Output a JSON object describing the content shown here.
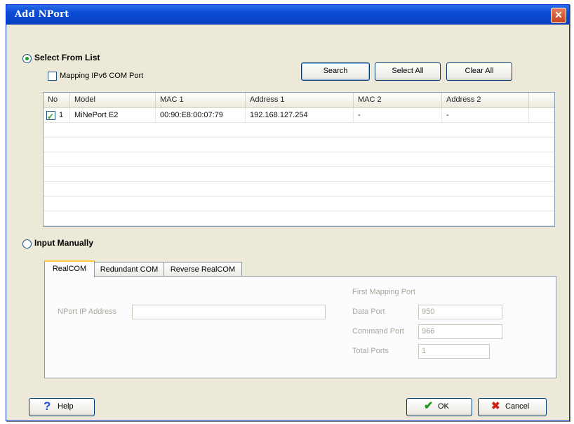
{
  "window": {
    "title": "Add NPort",
    "close_glyph": "✕"
  },
  "select_from_list": {
    "label": "Select From List",
    "mapping_ipv6_label": "Mapping IPv6 COM Port",
    "buttons": {
      "search": "Search",
      "select_all": "Select All",
      "clear_all": "Clear All"
    },
    "columns": [
      "No",
      "Model",
      "MAC 1",
      "Address 1",
      "MAC 2",
      "Address 2"
    ],
    "rows": [
      {
        "no": "1",
        "model": "MiNePort E2",
        "mac1": "00:90:E8:00:07:79",
        "address1": "192.168.127.254",
        "mac2": "-",
        "address2": "-"
      }
    ]
  },
  "input_manually": {
    "label": "Input Manually",
    "tabs": [
      "RealCOM",
      "Redundant COM",
      "Reverse RealCOM"
    ],
    "nport_ip_label": "NPort IP Address",
    "nport_ip_value": "",
    "first_mapping_port_label": "First Mapping Port",
    "data_port_label": "Data Port",
    "data_port_value": "950",
    "command_port_label": "Command Port",
    "command_port_value": "966",
    "total_ports_label": "Total Ports",
    "total_ports_value": "1"
  },
  "footer": {
    "help": "Help",
    "ok": "OK",
    "cancel": "Cancel"
  },
  "icons": {
    "help": "question-icon",
    "ok": "check-icon",
    "cancel": "x-icon"
  },
  "colors": {
    "title_bar": "#0a4bd6",
    "tab_highlight": "#ffc83c",
    "ok_check": "#1e9a1e",
    "cancel_x": "#d0221b",
    "help_q": "#1a4fd8"
  }
}
